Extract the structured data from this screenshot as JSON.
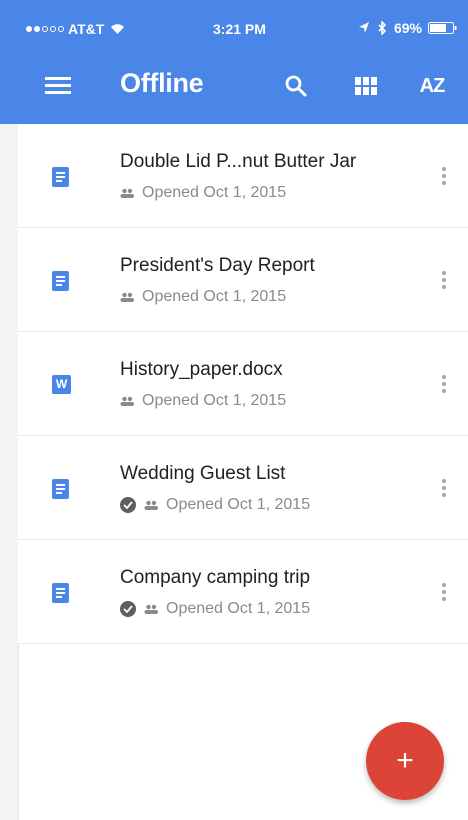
{
  "status_bar": {
    "carrier": "AT&T",
    "time": "3:21 PM",
    "battery": "69%"
  },
  "toolbar": {
    "title": "Offline",
    "sort_label": "AZ"
  },
  "files": [
    {
      "name": "Double Lid P...nut Butter Jar",
      "meta": "Opened Oct 1, 2015",
      "type": "doc",
      "offline": false
    },
    {
      "name": "President's Day Report",
      "meta": "Opened Oct 1, 2015",
      "type": "doc",
      "offline": false
    },
    {
      "name": "History_paper.docx",
      "meta": "Opened Oct 1, 2015",
      "type": "word",
      "offline": false,
      "icon_letter": "W"
    },
    {
      "name": "Wedding Guest List",
      "meta": "Opened Oct 1, 2015",
      "type": "doc",
      "offline": true
    },
    {
      "name": "Company camping trip",
      "meta": "Opened Oct 1, 2015",
      "type": "doc",
      "offline": true
    }
  ],
  "fab": {
    "label": "+"
  },
  "colors": {
    "app_bar": "#4a86e8",
    "doc_icon": "#4a86e8",
    "fab": "#db4437",
    "text_primary": "#212121",
    "text_secondary": "#8a8a8a"
  },
  "icons": {
    "menu": "menu-icon",
    "search": "search-icon",
    "grid": "grid-view-icon",
    "sort": "sort-az-icon",
    "shared": "shared-people-icon",
    "offline": "offline-check-icon",
    "more": "more-vert-icon",
    "add": "add-icon"
  }
}
